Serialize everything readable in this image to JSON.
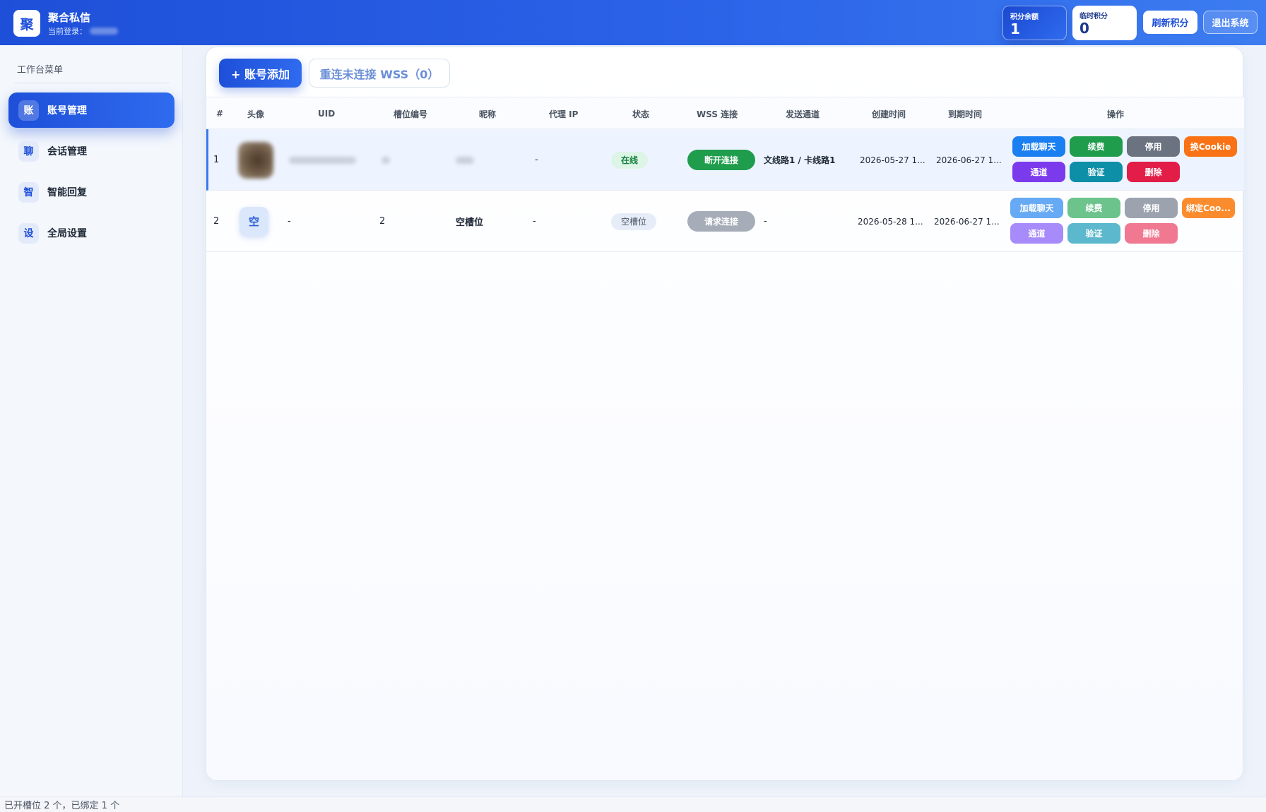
{
  "header": {
    "logo_char": "聚",
    "title": "聚合私信",
    "login_label": "当前登录：",
    "credit_balance_label": "积分余额",
    "credit_balance_value": "1",
    "temp_credit_label": "临时积分",
    "temp_credit_value": "0",
    "refresh_label": "刷新积分",
    "logout_label": "退出系统"
  },
  "sidebar": {
    "heading": "工作台菜单",
    "items": [
      {
        "badge": "账",
        "label": "账号管理",
        "active": true
      },
      {
        "badge": "聊",
        "label": "会话管理",
        "active": false
      },
      {
        "badge": "智",
        "label": "智能回复",
        "active": false
      },
      {
        "badge": "设",
        "label": "全局设置",
        "active": false
      }
    ]
  },
  "toolbar": {
    "add_label": "+ 账号添加",
    "reconnect_label": "重连未连接 WSS（0）"
  },
  "table": {
    "headers": [
      "#",
      "头像",
      "UID",
      "槽位编号",
      "昵称",
      "代理 IP",
      "状态",
      "WSS 连接",
      "发送通道",
      "创建时间",
      "到期时间",
      "操作"
    ],
    "rows": [
      {
        "index": "1",
        "avatar": "",
        "uid": "",
        "slot": "",
        "nickname": "",
        "proxy": "-",
        "status": "在线",
        "wss": "断开连接",
        "channel": "文线路1 / 卡线路1",
        "created": "2026-05-27 1...",
        "expires": "2026-06-27 1...",
        "actions": [
          "加载聊天",
          "续费",
          "停用",
          "换Cookie",
          "通道",
          "验证",
          "删除"
        ]
      },
      {
        "index": "2",
        "avatar": "空",
        "uid": "-",
        "slot": "2",
        "nickname": "空槽位",
        "proxy": "-",
        "status": "空槽位",
        "wss": "请求连接",
        "channel": "-",
        "created": "2026-05-28 1...",
        "expires": "2026-06-27 1...",
        "actions": [
          "加载聊天",
          "续费",
          "停用",
          "绑定Coo...",
          "通道",
          "验证",
          "删除"
        ]
      }
    ]
  },
  "footer": {
    "summary": "已开槽位 2 个，已绑定 1 个"
  },
  "colors": {
    "brand": "#1e4fd8",
    "load_chat": "#1a7ff0",
    "renew": "#1f9d4c",
    "disable": "#6b7280",
    "cookie": "#f97316",
    "channel": "#7c3aed",
    "verify": "#0e8fa8",
    "delete": "#e11d48"
  }
}
